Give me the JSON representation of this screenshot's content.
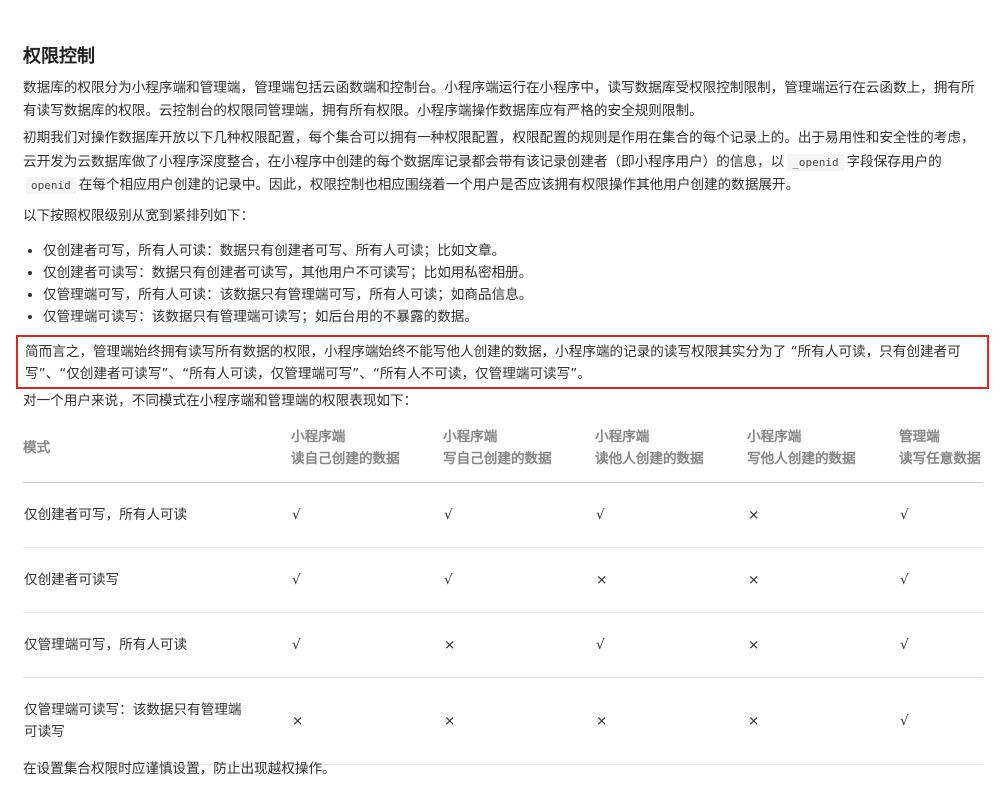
{
  "title": "权限控制",
  "paragraphs": {
    "p1": "数据库的权限分为小程序端和管理端，管理端包括云函数端和控制台。小程序端运行在小程序中，读写数据库受权限控制限制，管理端运行在云函数上，拥有所有读写数据库的权限。云控制台的权限同管理端，拥有所有权限。小程序端操作数据库应有严格的安全规则限制。",
    "p2a": "初期我们对操作数据库开放以下几种权限配置，每个集合可以拥有一种权限配置，权限配置的规则是作用在集合的每个记录上的。出于易用性和安全性的考虑，云开发为云数据库做了小程序深度整合，在小程序中创建的每个数据库记录都会带有该记录创建者（即小程序用户）的信息，以",
    "code1": "_openid",
    "p2b": "字段保存用户的",
    "code2": "openid",
    "p2c": "在每个相应用户创建的记录中。因此，权限控制也相应围绕着一个用户是否应该拥有权限操作其他用户创建的数据展开。",
    "p3": "以下按照权限级别从宽到紧排列如下：",
    "highlight": "简而言之，管理端始终拥有读写所有数据的权限，小程序端始终不能写他人创建的数据，小程序端的记录的读写权限其实分为了 “所有人可读，只有创建者可写”、“仅创建者可读写”、“所有人可读，仅管理端可写”、“所有人不可读，仅管理端可读写”。",
    "p4": "对一个用户来说，不同模式在小程序端和管理端的权限表现如下：",
    "p5": "在设置集合权限时应谨慎设置，防止出现越权操作。"
  },
  "bullets": [
    "仅创建者可写，所有人可读：数据只有创建者可写、所有人可读；比如文章。",
    "仅创建者可读写：数据只有创建者可读写，其他用户不可读写；比如用私密相册。",
    "仅管理端可写，所有人可读：该数据只有管理端可写，所有人可读；如商品信息。",
    "仅管理端可读写：该数据只有管理端可读写；如后台用的不暴露的数据。"
  ],
  "table": {
    "headers": [
      {
        "l1": "模式",
        "l2": ""
      },
      {
        "l1": "小程序端",
        "l2": "读自己创建的数据"
      },
      {
        "l1": "小程序端",
        "l2": "写自己创建的数据"
      },
      {
        "l1": "小程序端",
        "l2": "读他人创建的数据"
      },
      {
        "l1": "小程序端",
        "l2": "写他人创建的数据"
      },
      {
        "l1": "管理端",
        "l2": "读写任意数据"
      }
    ],
    "rows": [
      [
        "仅创建者可写，所有人可读",
        "√",
        "√",
        "√",
        "×",
        "√"
      ],
      [
        "仅创建者可读写",
        "√",
        "√",
        "×",
        "×",
        "√"
      ],
      [
        "仅管理端可写，所有人可读",
        "√",
        "×",
        "√",
        "×",
        "√"
      ],
      [
        "仅管理端可读写：该数据只有管理端可读写",
        "×",
        "×",
        "×",
        "×",
        "√"
      ]
    ]
  },
  "colors": {
    "highlight_border": "#e8231c"
  }
}
